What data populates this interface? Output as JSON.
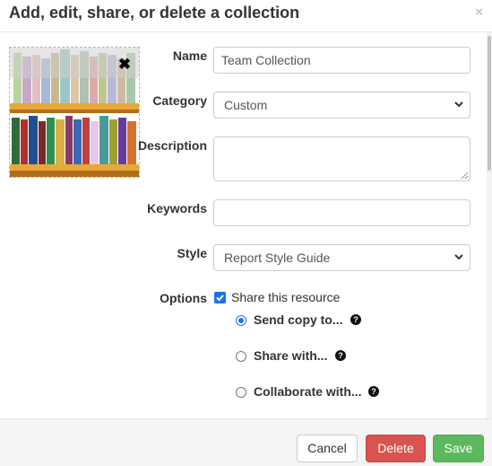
{
  "header": {
    "title": "Add, edit, share, or delete a collection",
    "close_icon": "×"
  },
  "image": {
    "remove_icon": "✖"
  },
  "form": {
    "name": {
      "label": "Name",
      "value": "Team Collection"
    },
    "category": {
      "label": "Category",
      "value": "Custom"
    },
    "description": {
      "label": "Description",
      "value": ""
    },
    "keywords": {
      "label": "Keywords",
      "value": ""
    },
    "style": {
      "label": "Style",
      "value": "Report Style Guide"
    },
    "options": {
      "label": "Options",
      "share_label": "Share this resource",
      "share_checked": true,
      "radios": [
        {
          "label": "Send copy to...",
          "checked": true,
          "help": "?"
        },
        {
          "label": "Share with...",
          "checked": false,
          "help": "?"
        },
        {
          "label": "Collaborate with...",
          "checked": false,
          "help": "?"
        }
      ]
    }
  },
  "footer": {
    "cancel": "Cancel",
    "delete": "Delete",
    "save": "Save"
  },
  "colors": {
    "accent": "#1a73e8",
    "danger": "#d9534f",
    "success": "#5cb85c"
  }
}
